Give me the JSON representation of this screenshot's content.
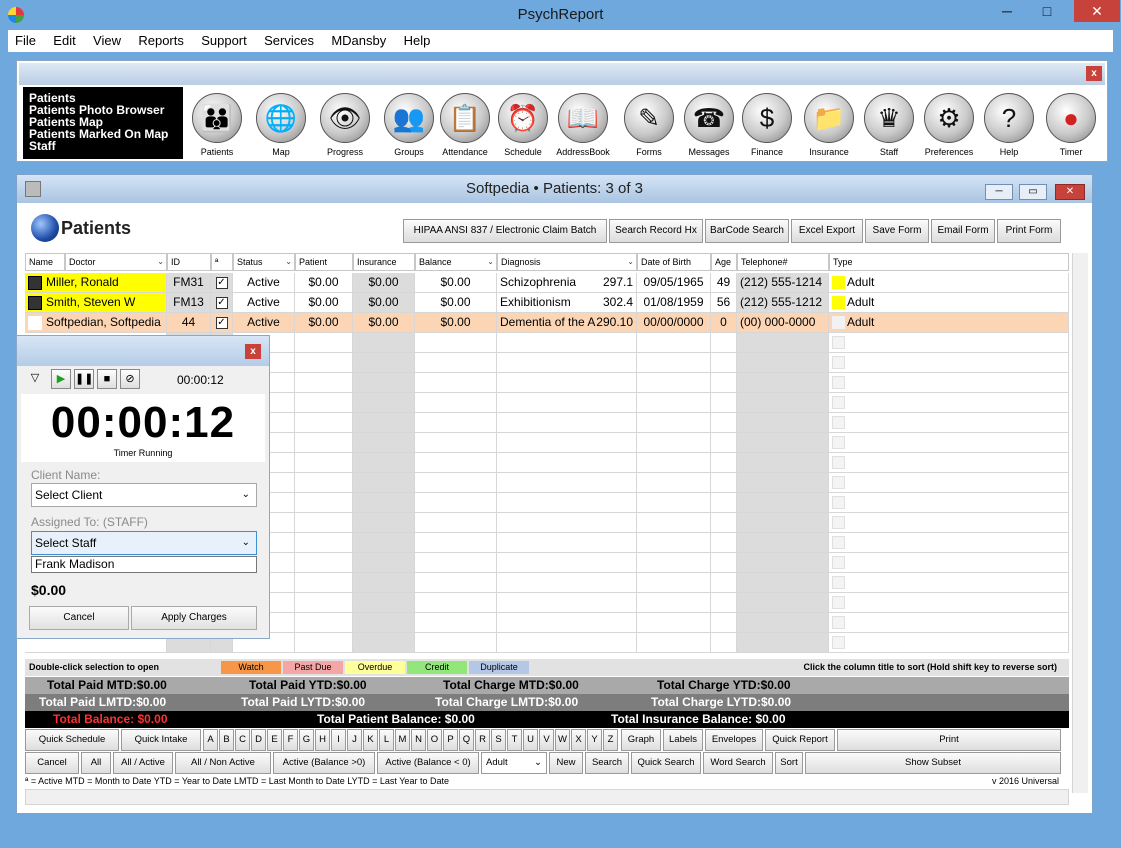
{
  "window": {
    "title": "PsychReport",
    "minimize": "─",
    "maximize": "□",
    "close": "✕"
  },
  "menu": [
    "File",
    "Edit",
    "View",
    "Reports",
    "Support",
    "Services",
    "MDansby",
    "Help"
  ],
  "toolbar": {
    "close": "x",
    "links": [
      "Patients",
      "Patients Photo Browser",
      "Patients Map",
      "Patients Marked On Map",
      "Staff"
    ],
    "buttons": [
      {
        "label": "Patients",
        "glyph": "👪"
      },
      {
        "label": "Map",
        "glyph": "🌐"
      },
      {
        "label": "Progress",
        "glyph": "👁"
      },
      {
        "label": "Groups",
        "glyph": "👥"
      },
      {
        "label": "Attendance",
        "glyph": "📋"
      },
      {
        "label": "Schedule",
        "glyph": "⏰"
      },
      {
        "label": "AddressBook",
        "glyph": "📖"
      },
      {
        "label": "Forms",
        "glyph": "✎"
      },
      {
        "label": "Messages",
        "glyph": "☎"
      },
      {
        "label": "Finance",
        "glyph": "$"
      },
      {
        "label": "Insurance",
        "glyph": "📁"
      },
      {
        "label": "Staff",
        "glyph": "♛"
      },
      {
        "label": "Preferences",
        "glyph": "⚙"
      },
      {
        "label": "Help",
        "glyph": "?"
      },
      {
        "label": "Timer",
        "glyph": "●"
      }
    ]
  },
  "child": {
    "title": "Softpedia  •  Patients: 3 of 3",
    "header": "Patients",
    "actions": [
      "HIPAA ANSI 837 / Electronic Claim Batch",
      "Search Record Hx",
      "BarCode Search",
      "Excel Export",
      "Save Form",
      "Email Form",
      "Print Form"
    ]
  },
  "grid": {
    "columns": [
      "Name",
      "Doctor",
      "ID",
      "ª",
      "Status",
      "Patient",
      "Insurance",
      "Balance",
      "Diagnosis",
      "Date of Birth",
      "Age",
      "Telephone#",
      "Type"
    ],
    "rows": [
      {
        "name": "Miller, Ronald",
        "id": "FM31",
        "status": "Active",
        "patient": "$0.00",
        "insurance": "$0.00",
        "balance": "$0.00",
        "diagnosis": "Schizophrenia",
        "dx_code": "297.1",
        "dob": "09/05/1965",
        "age": "49",
        "phone": "(212) 555-1214",
        "type": "Adult"
      },
      {
        "name": "Smith, Steven W",
        "id": "FM13",
        "status": "Active",
        "patient": "$0.00",
        "insurance": "$0.00",
        "balance": "$0.00",
        "diagnosis": "Exhibitionism",
        "dx_code": "302.4",
        "dob": "01/08/1959",
        "age": "56",
        "phone": "(212) 555-1212",
        "type": "Adult"
      },
      {
        "name": "Softpedian, Softpedia",
        "id": "44",
        "status": "Active",
        "patient": "$0.00",
        "insurance": "$0.00",
        "balance": "$0.00",
        "diagnosis": "Dementia of the Al",
        "dx_code": "290.10",
        "dob": "00/00/0000",
        "age": "0",
        "phone": "(00) 000-0000",
        "type": "Adult"
      }
    ]
  },
  "legend": {
    "hint_left": "Double-click selection to open",
    "hint_right": "Click the column title to sort   (Hold shift key to reverse sort)",
    "chips": [
      {
        "label": "Watch",
        "color": "#f79646"
      },
      {
        "label": "Past Due",
        "color": "#f4a6a6"
      },
      {
        "label": "Overdue",
        "color": "#ffff99"
      },
      {
        "label": "Credit",
        "color": "#92e67a"
      },
      {
        "label": "Duplicate",
        "color": "#b4c7e7"
      }
    ]
  },
  "totals": {
    "paid_mtd": "Total Paid MTD:$0.00",
    "paid_ytd": "Total Paid YTD:$0.00",
    "charge_mtd": "Total Charge MTD:$0.00",
    "charge_ytd": "Total Charge YTD:$0.00",
    "paid_lmtd": "Total Paid LMTD:$0.00",
    "paid_lytd": "Total Paid LYTD:$0.00",
    "charge_lmtd": "Total Charge LMTD:$0.00",
    "charge_lytd": "Total Charge LYTD:$0.00",
    "balance": "Total Balance: $0.00",
    "patient_balance": "Total Patient Balance: $0.00",
    "insurance_balance": "Total Insurance Balance: $0.00"
  },
  "buttons_row1": {
    "quick_schedule": "Quick Schedule",
    "quick_intake": "Quick Intake",
    "letters": [
      "A",
      "B",
      "C",
      "D",
      "E",
      "F",
      "G",
      "H",
      "I",
      "J",
      "K",
      "L",
      "M",
      "N",
      "O",
      "P",
      "Q",
      "R",
      "S",
      "T",
      "U",
      "V",
      "W",
      "X",
      "Y",
      "Z"
    ],
    "graph": "Graph",
    "labels": "Labels",
    "envelopes": "Envelopes",
    "quick_report": "Quick Report",
    "print": "Print"
  },
  "buttons_row2": {
    "cancel": "Cancel",
    "all": "All",
    "all_active": "All / Active",
    "all_non_active": "All / Non Active",
    "active_pos": "Active (Balance >0)",
    "active_neg": "Active (Balance < 0)",
    "type_select": "Adult",
    "new": "New",
    "search": "Search",
    "quick_search": "Quick Search",
    "word_search": "Word Search",
    "sort": "Sort",
    "show_subset": "Show Subset"
  },
  "footer": {
    "legend": "ª = Active       MTD = Month to Date       YTD = Year to Date       LMTD = Last Month to Date       LYTD = Last Year to Date",
    "version": "v 2016 Universal"
  },
  "timer": {
    "close": "x",
    "small": "00:00:12",
    "big": "00:00:12",
    "status": "Timer Running",
    "client_label": "Client Name:",
    "client_value": "Select Client",
    "assigned_label": "Assigned To:  (STAFF)",
    "staff_value": "Select Staff",
    "staff_option": "Frank Madison",
    "total": "$0.00",
    "cancel": "Cancel",
    "apply": "Apply Charges"
  },
  "colors": {
    "yellow_row": "#ffff00",
    "selected_row": "#fcd5b4",
    "type_chip": "#ffff00"
  }
}
